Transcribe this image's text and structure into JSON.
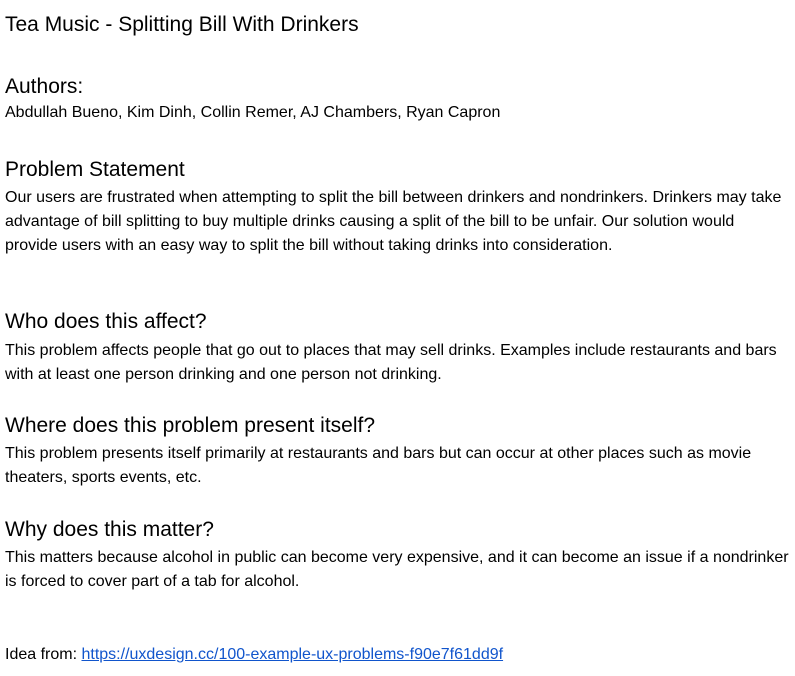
{
  "document": {
    "title": "Tea Music - Splitting Bill With Drinkers",
    "authors": {
      "heading": "Authors:",
      "names": "Abdullah Bueno, Kim Dinh, Collin Remer, AJ Chambers, Ryan Capron"
    },
    "sections": [
      {
        "heading": "Problem Statement",
        "body": "Our users are frustrated when attempting to split the bill between drinkers and nondrinkers. Drinkers may take advantage of bill splitting to buy multiple drinks causing a split of the bill to be unfair. Our solution would provide users with an easy way to split the bill without taking drinks into consideration."
      },
      {
        "heading": "Who does this affect?",
        "body": "This problem affects people that go out to places that may sell drinks. Examples include restaurants and bars with at least one person drinking and one person not drinking."
      },
      {
        "heading": "Where does this problem present itself?",
        "body": "This problem presents itself primarily at restaurants and bars but can occur at other places such as movie theaters, sports events, etc."
      },
      {
        "heading": "Why does this matter?",
        "body": "This matters because alcohol in public can become very expensive, and it can become an issue if a nondrinker is forced to cover part of a tab for alcohol."
      }
    ],
    "idea": {
      "prefix": "Idea from: ",
      "link_text": "https://uxdesign.cc/100-example-ux-problems-f90e7f61dd9f",
      "link_href": "https://uxdesign.cc/100-example-ux-problems-f90e7f61dd9f"
    },
    "colors": {
      "text": "#000000",
      "link": "#1155cc",
      "background": "#ffffff"
    }
  }
}
